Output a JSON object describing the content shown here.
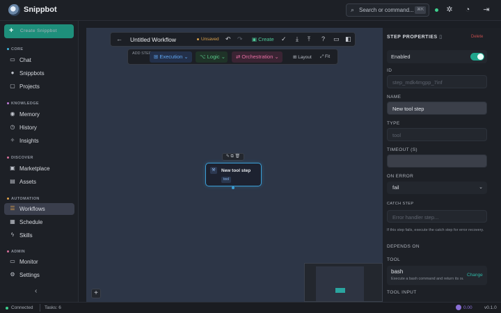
{
  "app": {
    "brand": "Snippbot",
    "search_placeholder": "Search or command...",
    "search_kbd": "⌘K"
  },
  "sidebar": {
    "create_label": "Create Snippbot",
    "sections": [
      {
        "label": "CORE",
        "color": "#3fb7e0"
      },
      {
        "label": "KNOWLEDGE",
        "color": "#c07bd8"
      },
      {
        "label": "DISCOVER",
        "color": "#d86f9b"
      },
      {
        "label": "AUTOMATION",
        "color": "#e2a34a"
      },
      {
        "label": "ADMIN",
        "color": "#d86f9b"
      }
    ],
    "items": [
      {
        "label": "Chat",
        "icon": "chat-icon"
      },
      {
        "label": "Snippbots",
        "icon": "user-icon"
      },
      {
        "label": "Projects",
        "icon": "folder-icon"
      },
      {
        "label": "Memory",
        "icon": "brain-icon"
      },
      {
        "label": "History",
        "icon": "clock-icon"
      },
      {
        "label": "Insights",
        "icon": "sparkle-icon"
      },
      {
        "label": "Marketplace",
        "icon": "bag-icon"
      },
      {
        "label": "Assets",
        "icon": "image-icon"
      },
      {
        "label": "Workflows",
        "icon": "workflow-icon"
      },
      {
        "label": "Schedule",
        "icon": "calendar-icon"
      },
      {
        "label": "Skills",
        "icon": "bolt-icon"
      },
      {
        "label": "Monitor",
        "icon": "monitor-icon"
      },
      {
        "label": "Settings",
        "icon": "gear-icon"
      }
    ],
    "active": "Workflows",
    "collapse_glyph": "‹"
  },
  "toolbar": {
    "title": "Untitled Workflow",
    "status": "Unsaved",
    "create_label": "Create"
  },
  "add_step": {
    "label": "ADD STEP:",
    "execution": "Execution",
    "logic": "Logic",
    "orchestration": "Orchestration",
    "layout": "Layout",
    "fit": "Fit"
  },
  "node": {
    "title": "New tool step",
    "tag": "tool",
    "tools": "✎ ⧉ 🗑"
  },
  "panel": {
    "title": "STEP PROPERTIES",
    "delete_label": "Delete",
    "enabled_label": "Enabled",
    "enabled": true,
    "id_label": "ID",
    "id_value": "step_mdk4mgpp_7inf",
    "name_label": "NAME",
    "name_value": "New tool step",
    "type_label": "TYPE",
    "type_value": "tool",
    "timeout_label": "TIMEOUT (S)",
    "timeout_value": "",
    "on_error_label": "ON ERROR",
    "on_error_value": "fail",
    "catch_label": "CATCH STEP",
    "catch_placeholder": "Error handler step...",
    "catch_hint": "If this step fails, execute the catch step for error recovery.",
    "depends_label": "DEPENDS ON",
    "tool_label": "TOOL",
    "tool_name": "bash",
    "tool_desc": "Execute a bash command and return its output",
    "tool_change": "Change",
    "tool_input_label": "TOOL INPUT"
  },
  "status": {
    "connected": "Connected",
    "tasks": "Tasks: 6",
    "cost": "0.00",
    "version": "v0.1.0"
  },
  "colors": {
    "accent": "#1e8f7b",
    "warning": "#d9a04a",
    "danger": "#c34c4c"
  }
}
